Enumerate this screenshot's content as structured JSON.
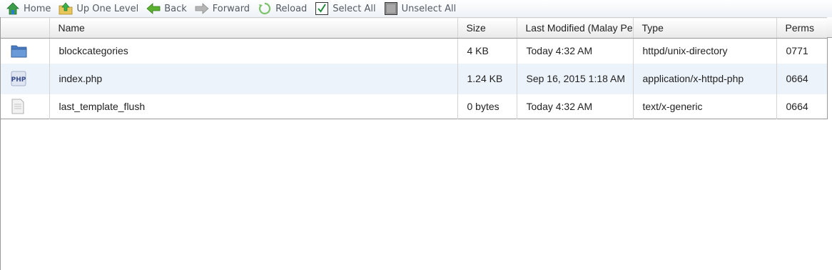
{
  "toolbar": {
    "home": "Home",
    "up_one_level": "Up One Level",
    "back": "Back",
    "forward": "Forward",
    "reload": "Reload",
    "select_all": "Select All",
    "unselect_all": "Unselect All"
  },
  "columns": {
    "name": "Name",
    "size": "Size",
    "last_modified": "Last Modified (Malay Pe",
    "type": "Type",
    "perms": "Perms"
  },
  "files": [
    {
      "icon": "folder-icon",
      "name": "blockcategories",
      "size": "4 KB",
      "modified": "Today 4:32 AM",
      "type": "httpd/unix-directory",
      "perms": "0771"
    },
    {
      "icon": "php-file-icon",
      "name": "index.php",
      "size": "1.24 KB",
      "modified": "Sep 16, 2015 1:18 AM",
      "type": "application/x-httpd-php",
      "perms": "0664"
    },
    {
      "icon": "generic-file-icon",
      "name": "last_template_flush",
      "size": "0 bytes",
      "modified": "Today 4:32 AM",
      "type": "text/x-generic",
      "perms": "0664"
    }
  ],
  "colors": {
    "row_alt": "#edf3fb",
    "folder": "#4a7cc4",
    "toolbar_text": "#555b63"
  }
}
